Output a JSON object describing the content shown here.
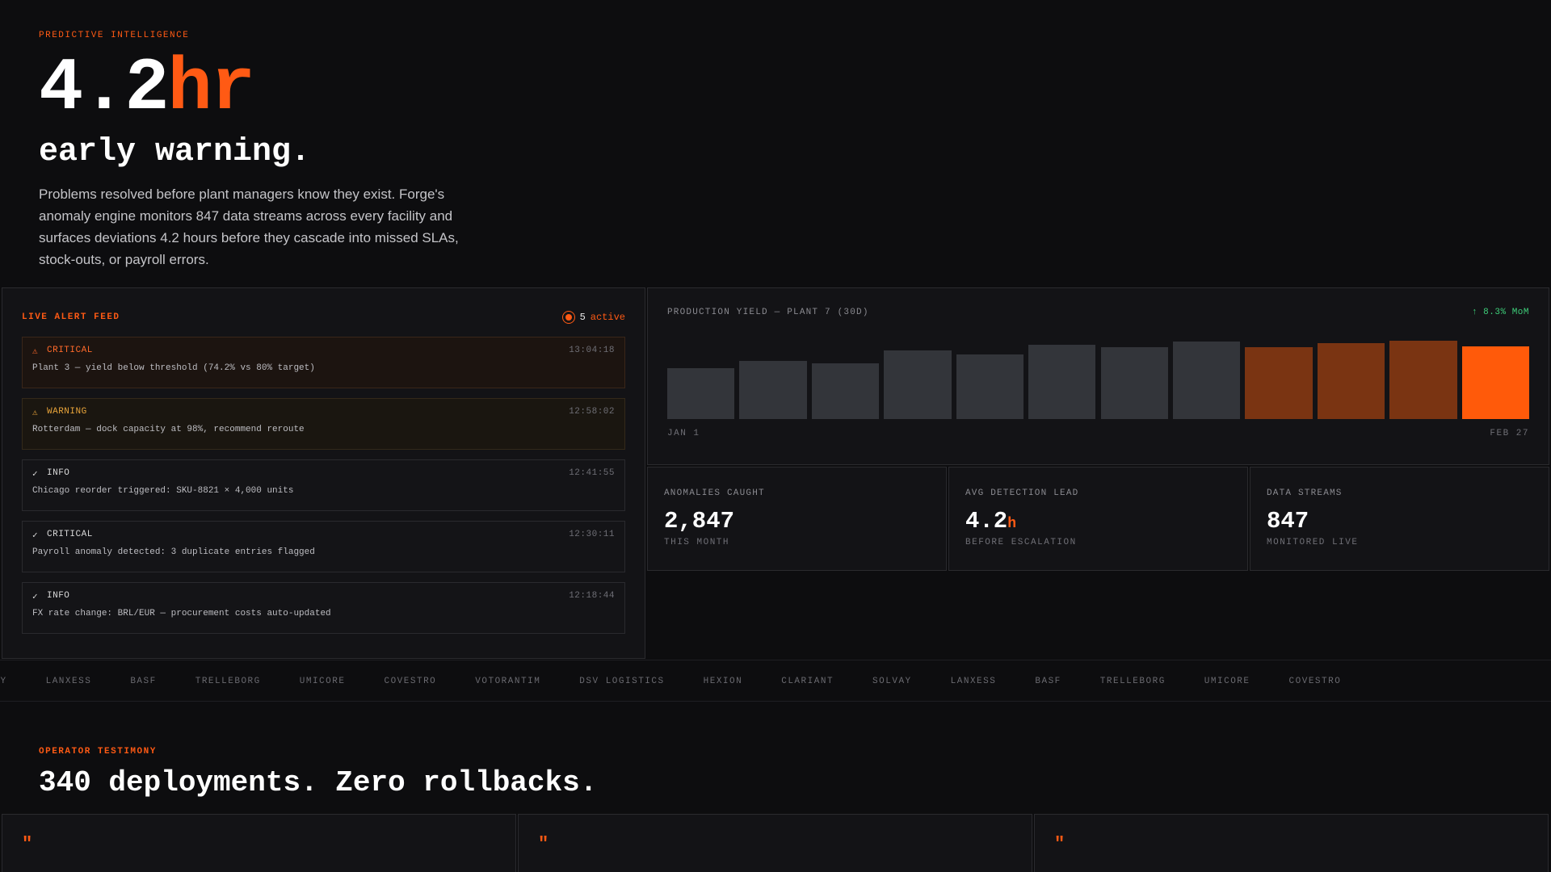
{
  "hero": {
    "eyebrow": "PREDICTIVE INTELLIGENCE",
    "number": "4.2",
    "unit": "hr",
    "headline": "early warning.",
    "lede": "Problems resolved before plant managers know they exist. Forge's anomaly engine monitors 847 data streams across every facility and surfaces deviations 4.2 hours before they cascade into missed SLAs, stock-outs, or payroll errors."
  },
  "alert_feed": {
    "title": "LIVE ALERT FEED",
    "active_count": "5",
    "active_label": "active",
    "alerts": [
      {
        "level": "CRITICAL",
        "icon": "warning-triangle-icon",
        "icon_glyph": "⚠",
        "time": "13:04:18",
        "message": "Plant 3 — yield below threshold (74.2% vs 80% target)"
      },
      {
        "level": "WARNING",
        "icon": "warning-triangle-icon",
        "icon_glyph": "⚠",
        "time": "12:58:02",
        "message": "Rotterdam — dock capacity at 98%, recommend reroute"
      },
      {
        "level": "INFO",
        "icon": "check-icon",
        "icon_glyph": "✓",
        "time": "12:41:55",
        "message": "Chicago reorder triggered: SKU-8821 × 4,000 units"
      },
      {
        "level": "CRITICAL",
        "icon": "check-icon",
        "icon_glyph": "✓",
        "time": "12:30:11",
        "message": "Payroll anomaly detected: 3 duplicate entries flagged"
      },
      {
        "level": "INFO",
        "icon": "check-icon",
        "icon_glyph": "✓",
        "time": "12:18:44",
        "message": "FX rate change: BRL/EUR — procurement costs auto-updated"
      }
    ]
  },
  "chart_data": {
    "type": "bar",
    "title": "PRODUCTION YIELD — PLANT 7 (30D)",
    "delta": "↑ 8.3% MoM",
    "x_start_label": "JAN 1",
    "x_end_label": "FEB 27",
    "values": [
      62,
      71,
      68,
      83,
      78,
      90,
      87,
      94,
      87,
      92,
      95,
      88
    ],
    "ylim": [
      0,
      100
    ],
    "highlight": [
      "base",
      "base",
      "base",
      "base",
      "base",
      "base",
      "base",
      "base",
      "recent",
      "recent",
      "recent",
      "current"
    ],
    "colors": {
      "base": "#33353a",
      "recent": "#7a3412",
      "current": "#ff5a0a"
    }
  },
  "stats": [
    {
      "label": "ANOMALIES CAUGHT",
      "value": "2,847",
      "unit": "",
      "sub": "THIS MONTH"
    },
    {
      "label": "AVG DETECTION LEAD",
      "value": "4.2",
      "unit": "h",
      "sub": "BEFORE ESCALATION"
    },
    {
      "label": "DATA STREAMS",
      "value": "847",
      "unit": "",
      "sub": "MONITORED LIVE"
    }
  ],
  "logos": [
    "SOLVAY",
    "LANXESS",
    "BASF",
    "TRELLEBORG",
    "UMICORE",
    "COVESTRO",
    "VOTORANTIM",
    "DSV LOGISTICS",
    "HEXION",
    "CLARIANT",
    "SOLVAY",
    "LANXESS",
    "BASF",
    "TRELLEBORG",
    "UMICORE",
    "COVESTRO"
  ],
  "testimony": {
    "eyebrow": "OPERATOR TESTIMONY",
    "title": "340 deployments. Zero rollbacks.",
    "quote_mark": "\""
  },
  "colors": {
    "accent": "#ff5a14",
    "positive": "#3ecf7a"
  }
}
